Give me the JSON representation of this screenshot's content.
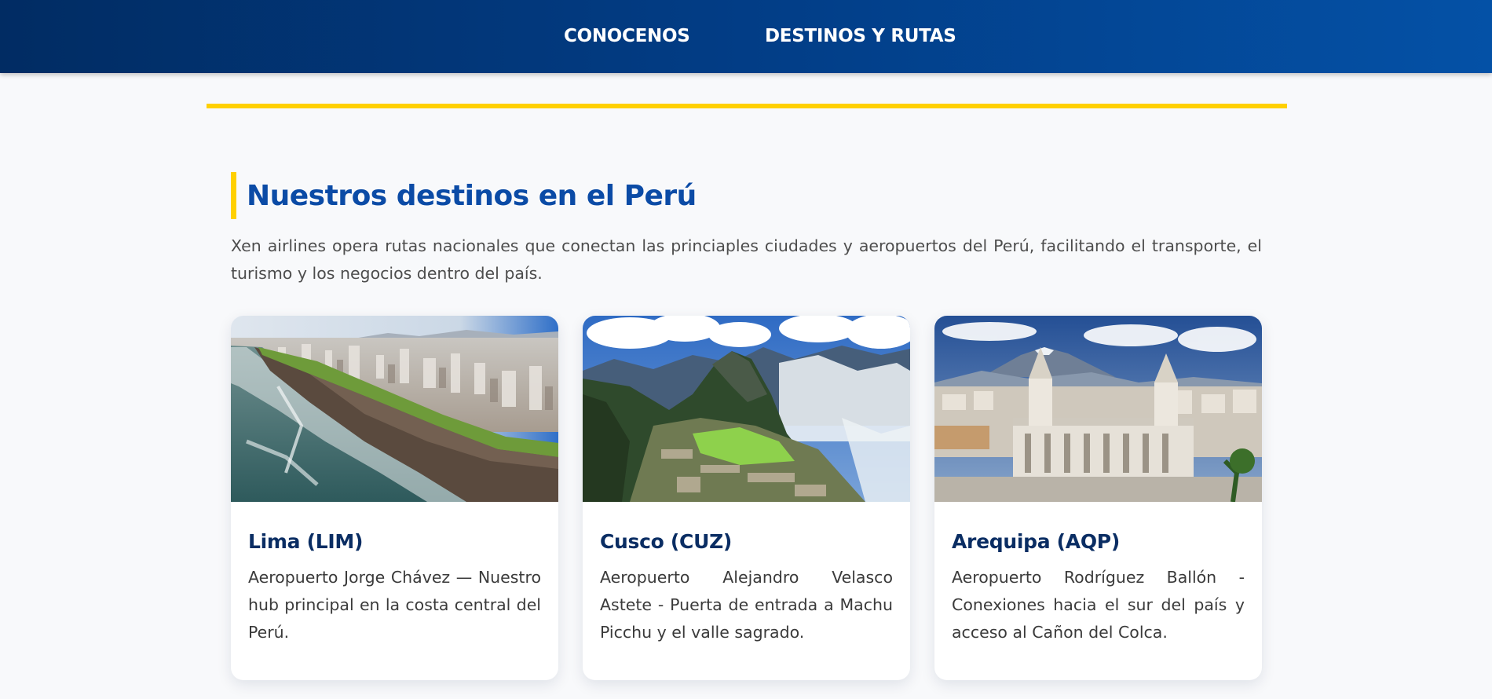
{
  "nav": {
    "items": [
      {
        "label": "CONOCENOS"
      },
      {
        "label": "DESTINOS Y RUTAS"
      }
    ]
  },
  "section": {
    "title": "Nuestros destinos en el Perú",
    "intro": "Xen airlines opera rutas nacionales que conectan las princiaples ciudades y aeropuertos del Perú, facilitando el transporte, el turismo y los negocios dentro del país."
  },
  "cards": [
    {
      "title": "Lima (LIM)",
      "description": "Aeropuerto Jorge Chávez — Nuestro hub principal en la costa central del Perú.",
      "image": "lima-coastline-photo"
    },
    {
      "title": "Cusco (CUZ)",
      "description": "Aeropuerto Alejandro Velasco Astete - Puerta de entrada a Machu Picchu y el valle sagrado.",
      "image": "machu-picchu-photo"
    },
    {
      "title": "Arequipa (AQP)",
      "description": "Aeropuerto Rodríguez Ballón - Conexiones hacia el sur del país y acceso al Cañon del Colca.",
      "image": "arequipa-cathedral-photo"
    }
  ],
  "colors": {
    "nav_dark": "#012c63",
    "nav_light": "#0451a6",
    "accent_yellow": "#ffd000",
    "title_blue": "#0b4ba6",
    "card_title": "#0a2d63"
  }
}
